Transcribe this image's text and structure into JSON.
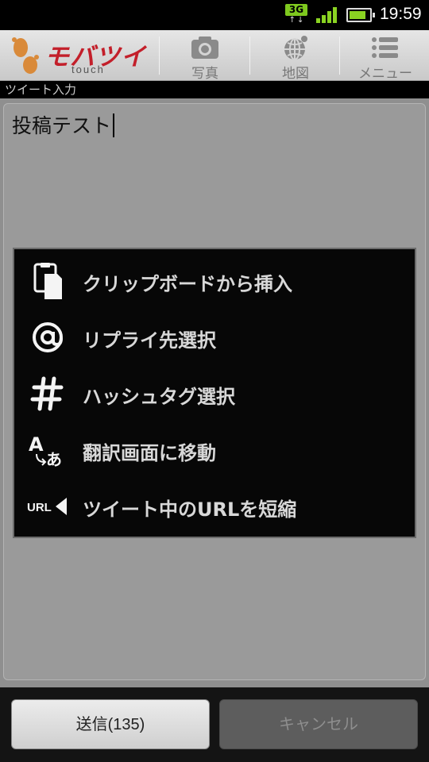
{
  "status_bar": {
    "network_type": "3G",
    "network_arrows": "↑↓",
    "time": "19:59",
    "battery_level": 0.85,
    "signal_bars": 4,
    "network_badge_color": "#7fc91f",
    "signal_color": "#8ad322"
  },
  "header": {
    "logo_text": "モバツイ",
    "logo_subtext": "touch",
    "brand_color": "#c31f2a",
    "buttons": [
      {
        "label": "写真",
        "icon": "camera-icon"
      },
      {
        "label": "地図",
        "icon": "globe-icon"
      },
      {
        "label": "メニュー",
        "icon": "menu-list-icon"
      }
    ]
  },
  "section_label": "ツイート入力",
  "tweet_input": {
    "value": "投稿テスト"
  },
  "menu": {
    "items": [
      {
        "label": "クリップボードから挿入",
        "icon": "clipboard-icon"
      },
      {
        "label": "リプライ先選択",
        "icon": "at-sign-icon"
      },
      {
        "label": "ハッシュタグ選択",
        "icon": "hashtag-icon"
      },
      {
        "label": "翻訳画面に移動",
        "icon": "translate-icon",
        "icon_text_a": "A",
        "icon_text_b": "あ"
      },
      {
        "label": "ツイート中のURLを短縮",
        "icon": "url-shorten-icon",
        "icon_text": "URL"
      }
    ]
  },
  "bottom_bar": {
    "send_label": "送信(135)",
    "cancel_label": "キャンセル"
  }
}
